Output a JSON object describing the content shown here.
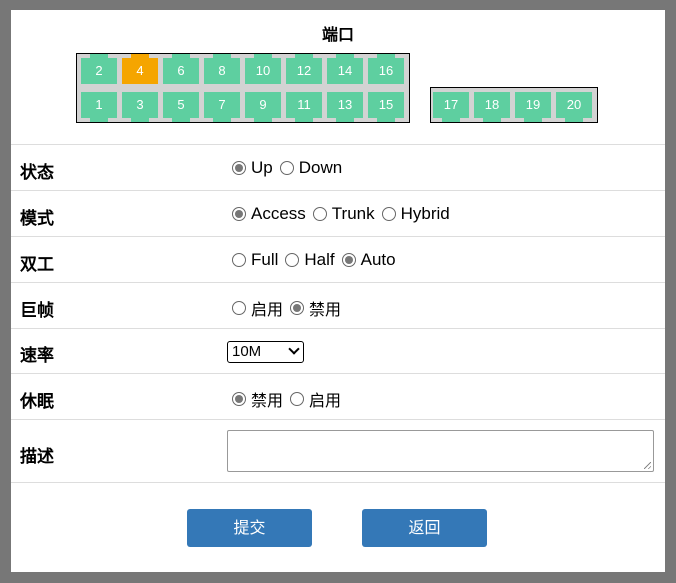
{
  "title": "端口",
  "ports": {
    "group1_top": [
      "2",
      "4",
      "6",
      "8",
      "10",
      "12",
      "14",
      "16"
    ],
    "group1_bottom": [
      "1",
      "3",
      "5",
      "7",
      "9",
      "11",
      "13",
      "15"
    ],
    "group2": [
      "17",
      "18",
      "19",
      "20"
    ],
    "selected": "4"
  },
  "status": {
    "label": "状态",
    "options": [
      {
        "label": "Up",
        "checked": true
      },
      {
        "label": "Down",
        "checked": false
      }
    ]
  },
  "mode": {
    "label": "模式",
    "options": [
      {
        "label": "Access",
        "checked": true
      },
      {
        "label": "Trunk",
        "checked": false
      },
      {
        "label": "Hybrid",
        "checked": false
      }
    ]
  },
  "duplex": {
    "label": "双工",
    "options": [
      {
        "label": "Full",
        "checked": false
      },
      {
        "label": "Half",
        "checked": false
      },
      {
        "label": "Auto",
        "checked": true
      }
    ]
  },
  "jumbo": {
    "label": "巨帧",
    "options": [
      {
        "label": "启用",
        "checked": false
      },
      {
        "label": "禁用",
        "checked": true
      }
    ]
  },
  "speed": {
    "label": "速率",
    "value": "10M"
  },
  "sleep": {
    "label": "休眠",
    "options": [
      {
        "label": "禁用",
        "checked": true
      },
      {
        "label": "启用",
        "checked": false
      }
    ]
  },
  "description": {
    "label": "描述",
    "value": ""
  },
  "buttons": {
    "submit": "提交",
    "back": "返回"
  }
}
